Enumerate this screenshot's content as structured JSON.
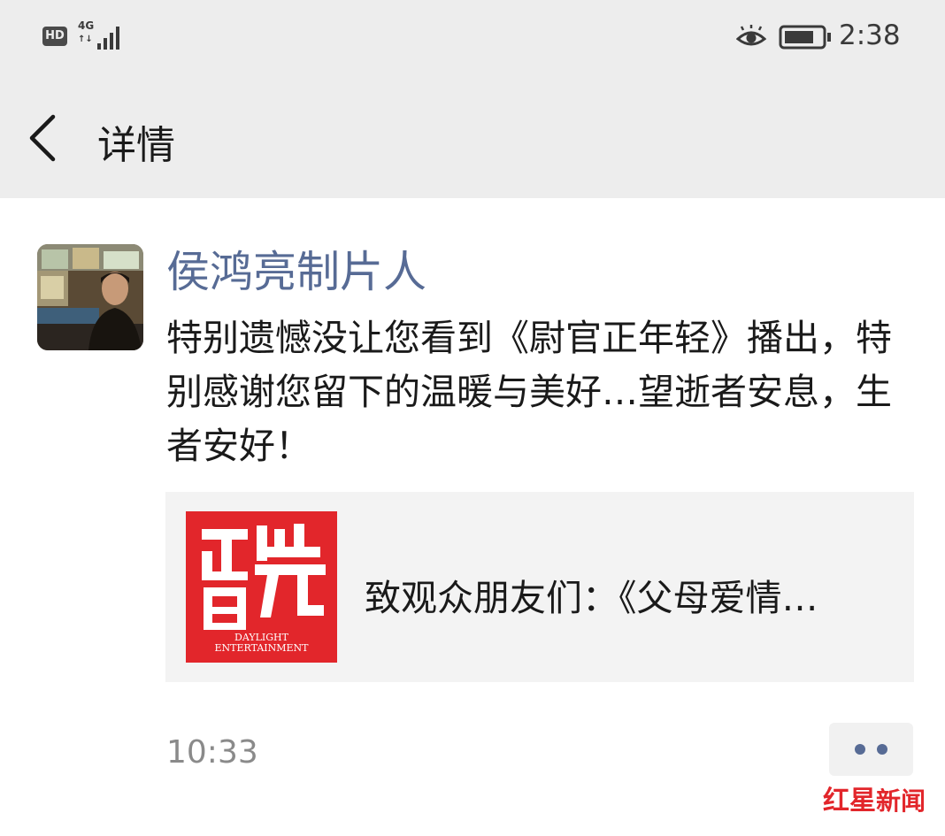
{
  "status_bar": {
    "hd_label": "HD",
    "network_label": "4G",
    "data_arrows": "↑↓",
    "time": "2:38",
    "icons": [
      "eye-icon",
      "battery-icon",
      "signal-icon"
    ]
  },
  "header": {
    "title": "详情",
    "back_icon": "chevron-left-icon"
  },
  "post": {
    "author": "侯鸿亮制片人",
    "text": "特别遗憾没让您看到《尉官正年轻》播出，特别感谢您留下的温暖与美好…望逝者安息，生者安好！",
    "link_card": {
      "logo_text_line1": "DAYLIGHT",
      "logo_text_line2": "ENTERTAINMENT",
      "title": "致观众朋友们：《父母爱情…"
    },
    "timestamp": "10:33"
  },
  "watermark": {
    "part1": "红",
    "part2": "星",
    "part3": "新闻"
  },
  "colors": {
    "link_blue": "#576b95",
    "logo_red": "#e2262b",
    "bar_gray": "#ededed",
    "card_gray": "#f3f3f3"
  }
}
